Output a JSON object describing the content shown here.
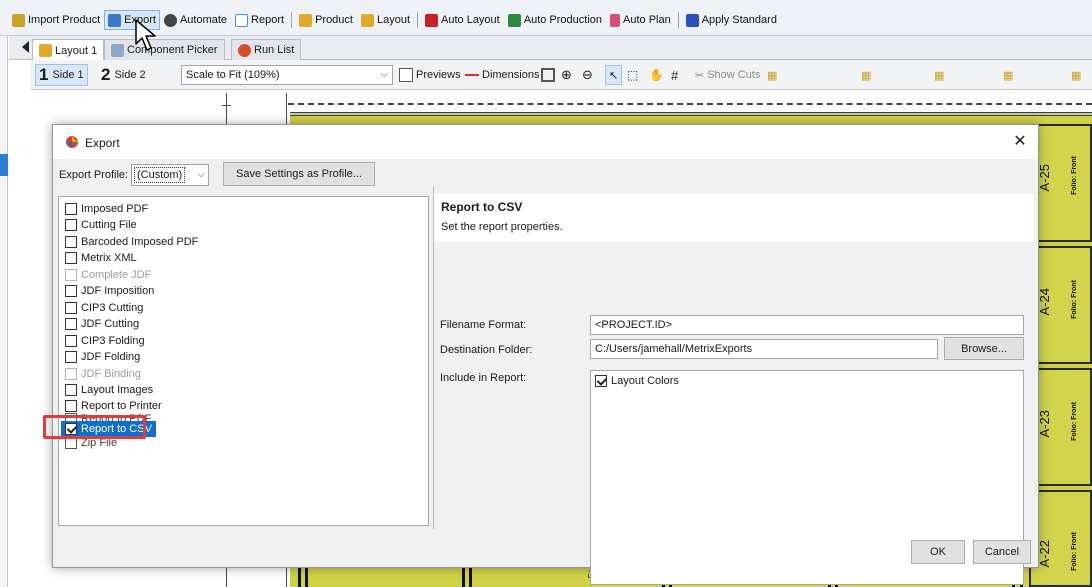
{
  "main_toolbar": {
    "items": [
      {
        "label": "Import Product",
        "icon": "import-icon",
        "color": "#c9a227"
      },
      {
        "label": "Export",
        "icon": "export-icon",
        "color": "#3a78c9",
        "active": true
      },
      {
        "label": "Automate",
        "icon": "automate-icon",
        "color": "#444444"
      },
      {
        "label": "Report",
        "icon": "report-icon",
        "color": "#4a90d9"
      },
      {
        "label": "Product",
        "icon": "product-icon",
        "color": "#e0a92a"
      },
      {
        "label": "Layout",
        "icon": "layout-icon",
        "color": "#e0a92a"
      },
      {
        "label": "Auto Layout",
        "icon": "auto-layout-icon",
        "color": "#c8202a"
      },
      {
        "label": "Auto Production",
        "icon": "auto-production-icon",
        "color": "#2b8a3e"
      },
      {
        "label": "Auto Plan",
        "icon": "auto-plan-icon",
        "color": "#d94f7a"
      },
      {
        "label": "Apply Standard",
        "icon": "apply-standard-icon",
        "color": "#2a52be"
      }
    ]
  },
  "layout_tabs": [
    {
      "label": "Layout 1",
      "icon": "layout-icon"
    },
    {
      "label": "Component Picker",
      "icon": "component-picker-icon"
    },
    {
      "label": "Run List",
      "icon": "run-list-icon"
    }
  ],
  "view_toolbar": {
    "side1": {
      "number": "1",
      "label": "Side 1"
    },
    "side2": {
      "number": "2",
      "label": "Side 2"
    },
    "zoom": "Scale to Fit (109%)",
    "previews": "Previews",
    "dimensions": "Dimensions",
    "show_cuts": "Show Cuts"
  },
  "canvas": {
    "panels": [
      {
        "label": "A-25",
        "folio": "Folio: Front"
      },
      {
        "label": "A-24",
        "folio": "Folio: Front"
      },
      {
        "label": "A-23",
        "folio": "Folio: Front"
      },
      {
        "label": "A-22",
        "folio": "Folio: Front"
      }
    ],
    "strip_labels": [
      "Fo",
      "Fo",
      "Fo"
    ]
  },
  "dialog": {
    "title": "Export",
    "close_glyph": "✕",
    "profile_label": "Export Profile:",
    "profile_value": "(Custom)",
    "save_profile_label": "Save Settings as Profile...",
    "options": [
      {
        "label": "Imposed PDF",
        "checked": false,
        "disabled": false
      },
      {
        "label": "Cutting File",
        "checked": false,
        "disabled": false
      },
      {
        "label": "Barcoded Imposed PDF",
        "checked": false,
        "disabled": false
      },
      {
        "label": "Metrix XML",
        "checked": false,
        "disabled": false
      },
      {
        "label": "Complete JDF",
        "checked": false,
        "disabled": true
      },
      {
        "label": "JDF Imposition",
        "checked": false,
        "disabled": false
      },
      {
        "label": "CIP3 Cutting",
        "checked": false,
        "disabled": false
      },
      {
        "label": "JDF Cutting",
        "checked": false,
        "disabled": false
      },
      {
        "label": "CIP3 Folding",
        "checked": false,
        "disabled": false
      },
      {
        "label": "JDF Folding",
        "checked": false,
        "disabled": false
      },
      {
        "label": "JDF Binding",
        "checked": false,
        "disabled": true
      },
      {
        "label": "Layout Images",
        "checked": false,
        "disabled": false
      },
      {
        "label": "Report to Printer",
        "checked": false,
        "disabled": false
      },
      {
        "label": "Report to PDF",
        "checked": false,
        "disabled": false
      },
      {
        "label": "Report to CSV",
        "checked": true,
        "disabled": false,
        "selected": true
      },
      {
        "label": "Zip File",
        "checked": false,
        "disabled": false
      }
    ],
    "properties": {
      "title": "Report to CSV",
      "description": "Set the report properties.",
      "filename_label": "Filename Format:",
      "filename_value": "<PROJECT.ID>",
      "destination_label": "Destination Folder:",
      "destination_value": "C:/Users/jamehall/MetrixExports",
      "browse_label": "Browse...",
      "include_label": "Include in Report:",
      "include_items": [
        {
          "label": "Layout Colors",
          "checked": true
        }
      ]
    },
    "ok_label": "OK",
    "cancel_label": "Cancel"
  },
  "colors": {
    "accent_selection": "#0e6fd1",
    "highlight_box": "#e33b3b",
    "sheet_yellow": "#cfd147"
  }
}
